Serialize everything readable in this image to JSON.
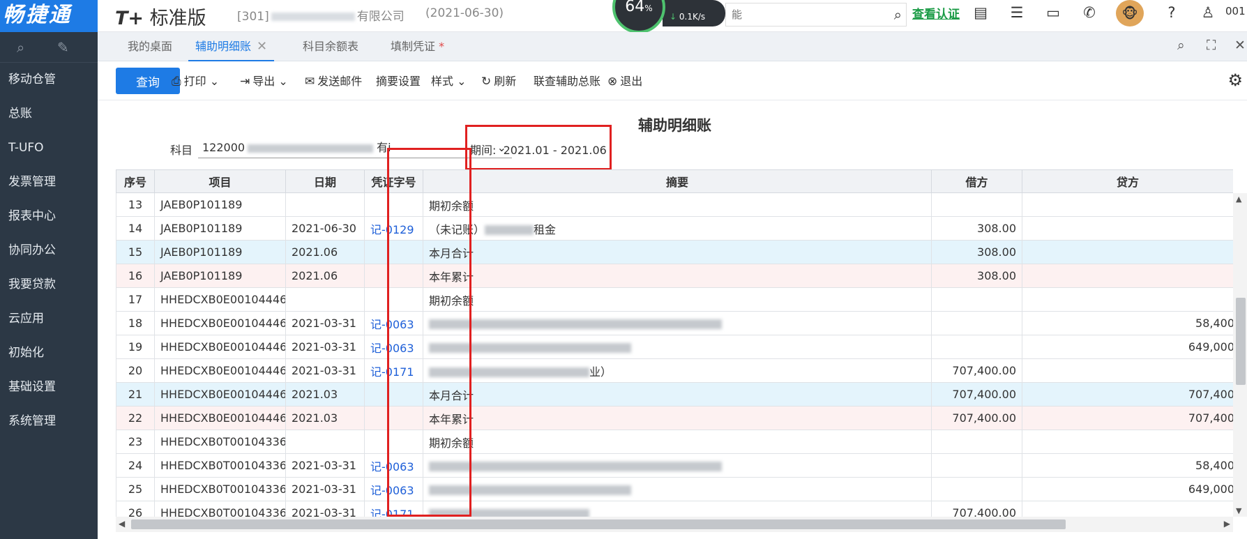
{
  "app": {
    "brand": "畅捷通",
    "product_prefix": "T+",
    "product_name": "标准版",
    "company_code": "[301]",
    "company_suffix": "有限公司",
    "account_date": "(2021-06-30)",
    "accent_color": "#1e7be5",
    "verify_label": "查看认证",
    "user_id": "001"
  },
  "netmeter": {
    "percent": "64",
    "percent_unit": "%",
    "speed": "0.1K/s"
  },
  "search": {
    "placeholder": "能"
  },
  "sidebar": {
    "items": [
      {
        "label": "移动仓管"
      },
      {
        "label": "总账"
      },
      {
        "label": "T-UFO"
      },
      {
        "label": "发票管理"
      },
      {
        "label": "报表中心"
      },
      {
        "label": "协同办公"
      },
      {
        "label": "我要贷款"
      },
      {
        "label": "云应用"
      },
      {
        "label": "初始化"
      },
      {
        "label": "基础设置"
      },
      {
        "label": "系统管理"
      }
    ]
  },
  "tabs": [
    {
      "label": "我的桌面"
    },
    {
      "label": "辅助明细账",
      "close": "✕"
    },
    {
      "label": "科目余额表"
    },
    {
      "label": "填制凭证",
      "marker": "*"
    }
  ],
  "toolbar": {
    "query": "查询",
    "print": "打印",
    "export": "导出",
    "send_mail": "发送邮件",
    "summary_settings": "摘要设置",
    "style": "样式",
    "refresh": "刷新",
    "linked_query": "联查辅助总账",
    "exit": "退出"
  },
  "report": {
    "title": "辅助明细账",
    "subject_label": "科目",
    "subject_code": "122000",
    "subject_tail": "有i",
    "period_label": "期间:",
    "period_value": "2021.01 - 2021.06"
  },
  "table": {
    "headers": [
      "序号",
      "项目",
      "日期",
      "凭证字号",
      "摘要",
      "借方",
      "贷方"
    ],
    "rows": [
      {
        "no": "13",
        "item": "JAEB0P101189",
        "date": "",
        "voucher": "",
        "summary": "期初余额",
        "debit": "",
        "credit": "",
        "type": "normal"
      },
      {
        "no": "14",
        "item": "JAEB0P101189",
        "date": "2021-06-30",
        "voucher": "记-0129",
        "summary": "（未记账）",
        "summary_tail": "租金",
        "debit": "308.00",
        "credit": "",
        "type": "normal"
      },
      {
        "no": "15",
        "item": "JAEB0P101189",
        "date": "2021.06",
        "voucher": "",
        "summary": "本月合计",
        "debit": "308.00",
        "credit": "",
        "type": "month"
      },
      {
        "no": "16",
        "item": "JAEB0P101189",
        "date": "2021.06",
        "voucher": "",
        "summary": "本年累计",
        "debit": "308.00",
        "credit": "",
        "type": "year"
      },
      {
        "no": "17",
        "item": "HHEDCXB0E00104446",
        "date": "",
        "voucher": "",
        "summary": "期初余额",
        "debit": "",
        "credit": "",
        "type": "normal"
      },
      {
        "no": "18",
        "item": "HHEDCXB0E00104446",
        "date": "2021-03-31",
        "voucher": "记-0063",
        "summary": "",
        "debit": "",
        "credit": "58,400",
        "type": "normal",
        "blur": true
      },
      {
        "no": "19",
        "item": "HHEDCXB0E00104446",
        "date": "2021-03-31",
        "voucher": "记-0063",
        "summary": "",
        "debit": "",
        "credit": "649,000",
        "type": "normal",
        "blur": true
      },
      {
        "no": "20",
        "item": "HHEDCXB0E00104446",
        "date": "2021-03-31",
        "voucher": "记-0171",
        "summary": "",
        "summary_tail": "业）",
        "debit": "707,400.00",
        "credit": "",
        "type": "normal",
        "blur": true
      },
      {
        "no": "21",
        "item": "HHEDCXB0E00104446",
        "date": "2021.03",
        "voucher": "",
        "summary": "本月合计",
        "debit": "707,400.00",
        "credit": "707,400",
        "type": "month"
      },
      {
        "no": "22",
        "item": "HHEDCXB0E00104446",
        "date": "2021.03",
        "voucher": "",
        "summary": "本年累计",
        "debit": "707,400.00",
        "credit": "707,400",
        "type": "year"
      },
      {
        "no": "23",
        "item": "HHEDCXB0T00104336",
        "date": "",
        "voucher": "",
        "summary": "期初余额",
        "debit": "",
        "credit": "",
        "type": "normal"
      },
      {
        "no": "24",
        "item": "HHEDCXB0T00104336",
        "date": "2021-03-31",
        "voucher": "记-0063",
        "summary": "",
        "debit": "",
        "credit": "58,400",
        "type": "normal",
        "blur": true
      },
      {
        "no": "25",
        "item": "HHEDCXB0T00104336",
        "date": "2021-03-31",
        "voucher": "记-0063",
        "summary": "",
        "debit": "",
        "credit": "649,000",
        "type": "normal",
        "blur": true
      },
      {
        "no": "26",
        "item": "HHEDCXB0T00104336",
        "date": "2021-03-31",
        "voucher": "记-0171",
        "summary": "",
        "debit": "707,400.00",
        "credit": "",
        "type": "normal",
        "blur": true
      }
    ]
  }
}
